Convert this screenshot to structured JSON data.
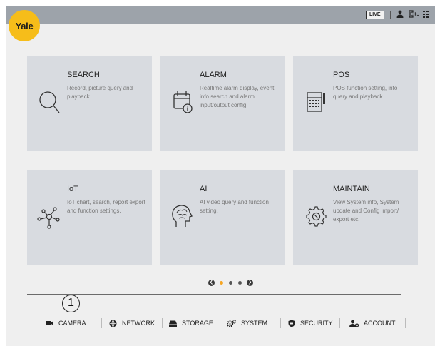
{
  "logo": {
    "text": "Yale"
  },
  "topbar": {
    "live_label": "LIVE",
    "user_icon": "user-icon",
    "logout_icon": "logout-icon",
    "menu_icon": "menu-grid-icon"
  },
  "tiles": [
    {
      "title": "SEARCH",
      "description": "Record, picture query and playback.",
      "icon": "magnifier-icon"
    },
    {
      "title": "ALARM",
      "description": "Realtime alarm display, event info search and alarm input/output config.",
      "icon": "calendar-info-icon"
    },
    {
      "title": "POS",
      "description": "POS function setting, info query and playback.",
      "icon": "pos-terminal-icon"
    },
    {
      "title": "IoT",
      "description": "IoT chart, search, report export and function settings.",
      "icon": "iot-network-icon"
    },
    {
      "title": "AI",
      "description": "AI video query and function setting.",
      "icon": "ai-head-icon"
    },
    {
      "title": "MAINTAIN",
      "description": "View System info, System update and Config import/ export etc.",
      "icon": "maintain-gear-icon"
    }
  ],
  "pager": {
    "pages": 3,
    "active_page": 1,
    "active_color": "#f6a623",
    "inactive_color": "#555555"
  },
  "annotation": {
    "number": "1"
  },
  "bottom_nav": [
    {
      "label": "CAMERA",
      "icon": "camera-icon"
    },
    {
      "label": "NETWORK",
      "icon": "globe-icon"
    },
    {
      "label": "STORAGE",
      "icon": "storage-icon"
    },
    {
      "label": "SYSTEM",
      "icon": "gears-icon"
    },
    {
      "label": "SECURITY",
      "icon": "shield-icon"
    },
    {
      "label": "ACCOUNT",
      "icon": "account-icon"
    }
  ],
  "colors": {
    "brand": "#f6bd1a",
    "topbar": "#9da3aa",
    "tile": "#d8dbe0",
    "background": "#efefef"
  }
}
